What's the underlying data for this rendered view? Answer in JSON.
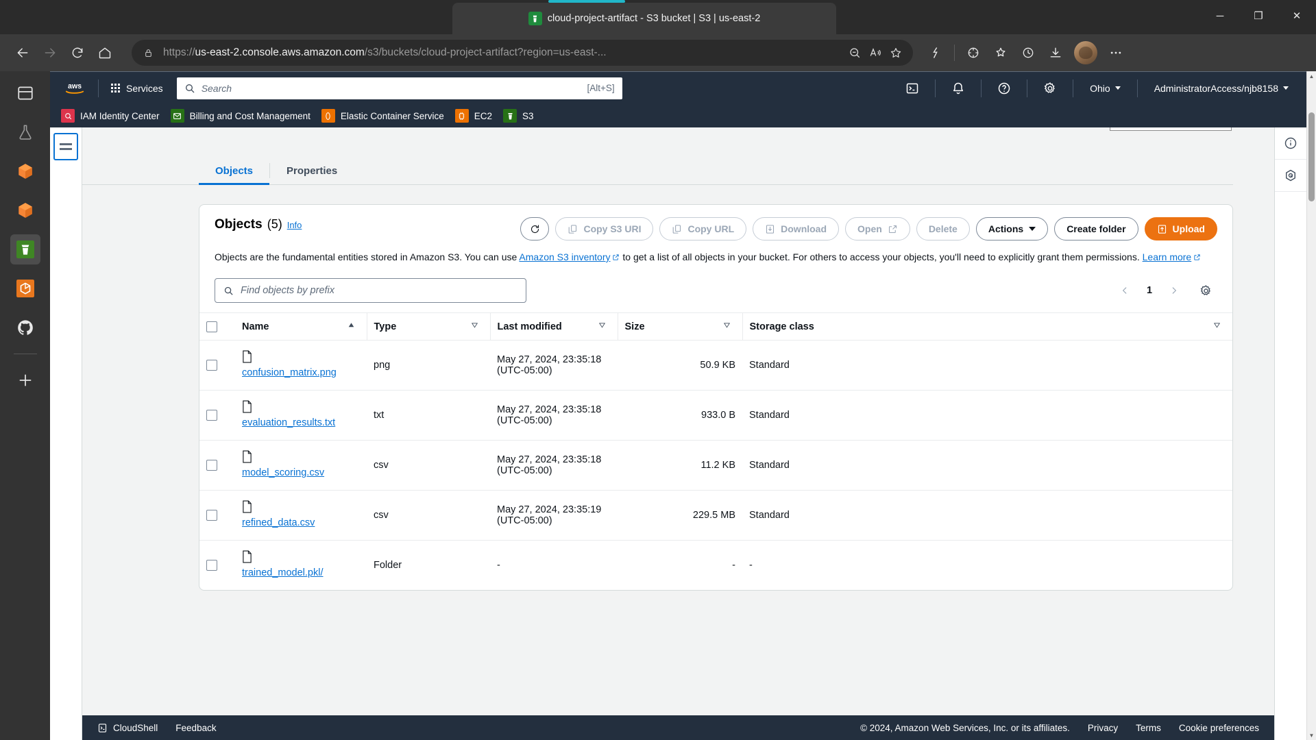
{
  "browser": {
    "tab_title": "cloud-project-artifact - S3 bucket | S3 | us-east-2",
    "url_prefix": "https://",
    "url_bold": "us-east-2.console.aws.amazon.com",
    "url_rest": "/s3/buckets/cloud-project-artifact?region=us-east-...",
    "controls": {
      "minimize": "─",
      "maximize": "❐",
      "close": "✕"
    }
  },
  "rail": {
    "items": [
      {
        "name": "sidebar-toggle-icon",
        "label": "Toggle sidebar"
      },
      {
        "name": "flask-icon",
        "label": "Experiments"
      },
      {
        "name": "orange-cube-icon-1",
        "label": "Package"
      },
      {
        "name": "orange-cube-icon-2",
        "label": "Package"
      },
      {
        "name": "s3-bucket-icon",
        "label": "S3"
      },
      {
        "name": "orange-box-icon",
        "label": "Service"
      },
      {
        "name": "github-icon",
        "label": "GitHub"
      },
      {
        "name": "add-icon",
        "label": "Add"
      }
    ]
  },
  "aws_nav": {
    "services_label": "Services",
    "search_placeholder": "Search",
    "search_shortcut": "[Alt+S]",
    "region": "Ohio",
    "account": "AdministratorAccess/njb8158"
  },
  "favorites": [
    {
      "label": "IAM Identity Center",
      "color": "#dd344c"
    },
    {
      "label": "Billing and Cost Management",
      "color": "#277116"
    },
    {
      "label": "Elastic Container Service",
      "color": "#ed7100"
    },
    {
      "label": "EC2",
      "color": "#ed7100"
    },
    {
      "label": "S3",
      "color": "#277116"
    }
  ],
  "tabs": [
    {
      "label": "Objects",
      "selected": true
    },
    {
      "label": "Properties",
      "selected": false
    }
  ],
  "panel": {
    "title": "Objects",
    "count": "(5)",
    "info_label": "Info",
    "description_part1": "Objects are the fundamental entities stored in Amazon S3. You can use ",
    "description_link1": "Amazon S3 inventory",
    "description_part2": " to get a list of all objects in your bucket. For others to access your objects, you'll need to explicitly grant them permissions. ",
    "description_link2": "Learn more",
    "buttons": {
      "refresh": "",
      "copy_s3_uri": "Copy S3 URI",
      "copy_url": "Copy URL",
      "download": "Download",
      "open": "Open",
      "delete": "Delete",
      "actions": "Actions",
      "create_folder": "Create folder",
      "upload": "Upload"
    },
    "filter_placeholder": "Find objects by prefix",
    "page_number": "1"
  },
  "table": {
    "columns": [
      {
        "key": "name",
        "label": "Name",
        "sort": "asc"
      },
      {
        "key": "type",
        "label": "Type",
        "sort": "none"
      },
      {
        "key": "last_modified",
        "label": "Last modified",
        "sort": "none"
      },
      {
        "key": "size",
        "label": "Size",
        "sort": "none"
      },
      {
        "key": "storage_class",
        "label": "Storage class",
        "sort": "none"
      }
    ],
    "rows": [
      {
        "name": "confusion_matrix.png",
        "type": "png",
        "last_modified": "May 27, 2024, 23:35:18 (UTC-05:00)",
        "size": "50.9 KB",
        "storage_class": "Standard"
      },
      {
        "name": "evaluation_results.txt",
        "type": "txt",
        "last_modified": "May 27, 2024, 23:35:18 (UTC-05:00)",
        "size": "933.0 B",
        "storage_class": "Standard"
      },
      {
        "name": "model_scoring.csv",
        "type": "csv",
        "last_modified": "May 27, 2024, 23:35:18 (UTC-05:00)",
        "size": "11.2 KB",
        "storage_class": "Standard"
      },
      {
        "name": "refined_data.csv",
        "type": "csv",
        "last_modified": "May 27, 2024, 23:35:19 (UTC-05:00)",
        "size": "229.5 MB",
        "storage_class": "Standard"
      },
      {
        "name": "trained_model.pkl/",
        "type": "Folder",
        "last_modified": "-",
        "size": "-",
        "storage_class": "-"
      }
    ]
  },
  "footer": {
    "cloudshell": "CloudShell",
    "feedback": "Feedback",
    "copyright": "© 2024, Amazon Web Services, Inc. or its affiliates.",
    "privacy": "Privacy",
    "terms": "Terms",
    "cookies": "Cookie preferences"
  },
  "colors": {
    "aws_navy": "#232f3e",
    "aws_orange": "#ec7211",
    "link_blue": "#0972d3"
  }
}
